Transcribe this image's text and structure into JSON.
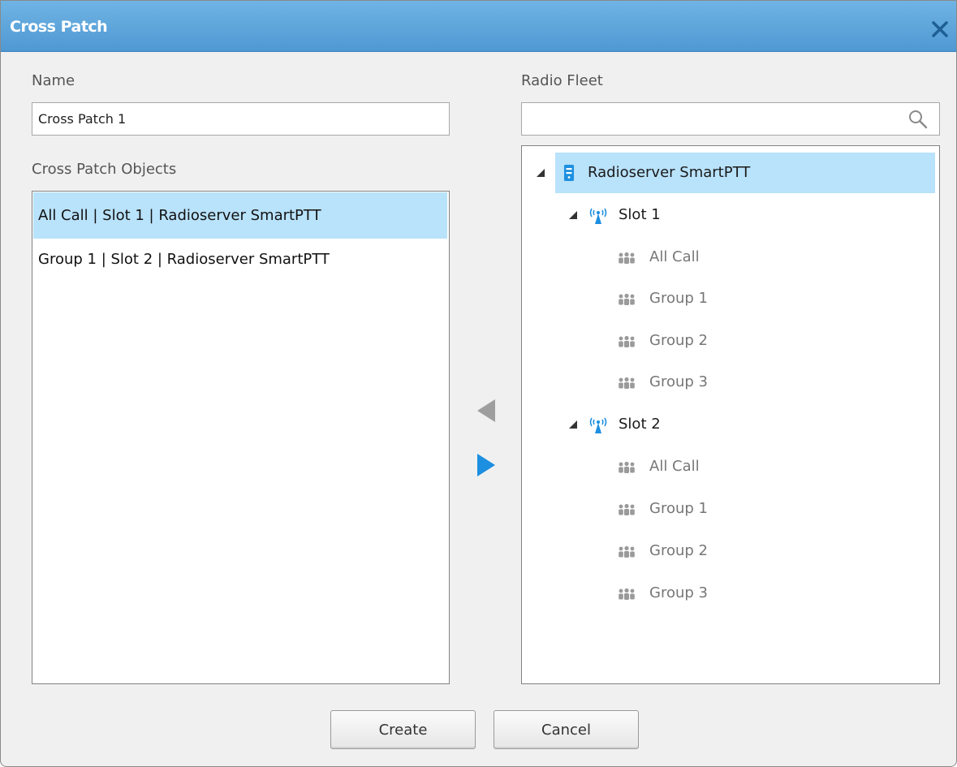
{
  "window": {
    "title": "Cross Patch",
    "close_icon": "close-x-icon"
  },
  "name_section": {
    "label": "Name",
    "value": "Cross Patch 1"
  },
  "objects_section": {
    "label": "Cross Patch Objects",
    "items": [
      {
        "text": "All Call | Slot 1 | Radioserver SmartPTT",
        "selected": true
      },
      {
        "text": "Group 1 | Slot 2 | Radioserver SmartPTT",
        "selected": false
      }
    ]
  },
  "fleet_section": {
    "label": "Radio Fleet",
    "search_value": "",
    "search_icon": "search-icon",
    "tree": {
      "root": {
        "label": "Radioserver SmartPTT",
        "icon": "radioserver-icon",
        "expanded": true,
        "selected": true
      },
      "slots": [
        {
          "label": "Slot 1",
          "icon": "radio-tower-icon",
          "expanded": true,
          "groups": [
            "All Call",
            "Group 1",
            "Group 2",
            "Group 3"
          ]
        },
        {
          "label": "Slot 2",
          "icon": "radio-tower-icon",
          "expanded": true,
          "groups": [
            "All Call",
            "Group 1",
            "Group 2",
            "Group 3"
          ]
        }
      ],
      "group_icon": "group-icon"
    }
  },
  "transfer": {
    "remove_icon": "arrow-left-icon",
    "add_icon": "arrow-right-icon"
  },
  "buttons": {
    "create": "Create",
    "cancel": "Cancel"
  },
  "colors": {
    "titlebar": "#5aa3da",
    "selection": "#b9e2fb",
    "accent": "#1d8fe0",
    "disabled_arrow": "#9e9e9e"
  }
}
